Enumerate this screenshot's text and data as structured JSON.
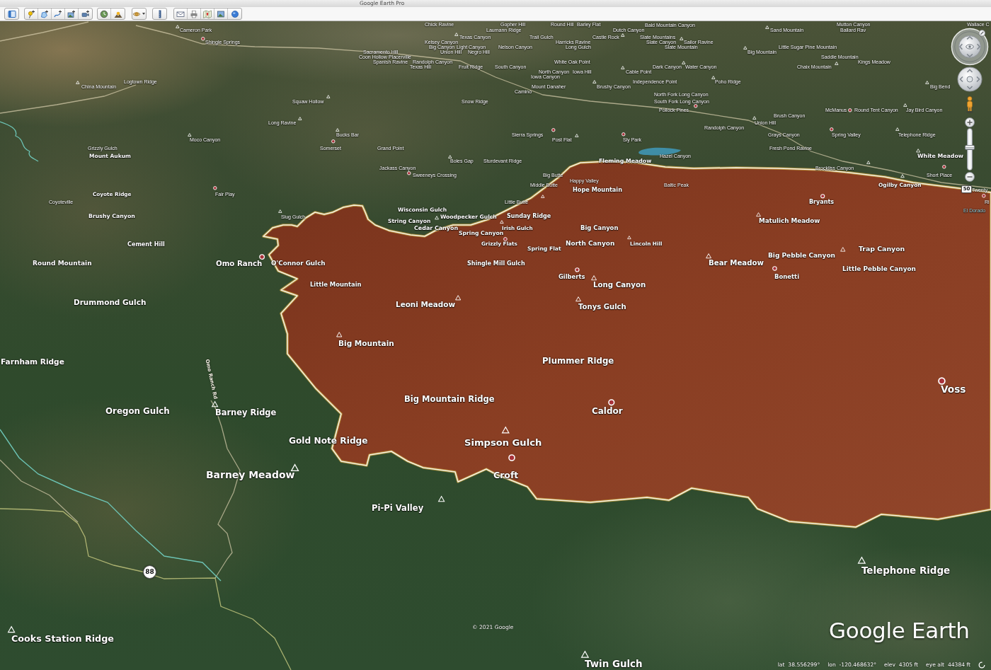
{
  "window": {
    "title": "Google Earth Pro"
  },
  "map": {
    "places": [
      {
        "name": "Chick Ravine",
        "kind": "feature"
      },
      {
        "name": "Gopher Hill",
        "kind": "feature"
      },
      {
        "name": "Round Hill",
        "kind": "feature"
      },
      {
        "name": "Barley Flat",
        "kind": "feature"
      },
      {
        "name": "Bald Mountain Canyon",
        "kind": "feature"
      },
      {
        "name": "Mutton Canyon",
        "kind": "feature"
      },
      {
        "name": "Wallace C",
        "kind": "feature"
      },
      {
        "name": "Cameron Park",
        "kind": "summit"
      },
      {
        "name": "Laumann Ridge",
        "kind": "feature"
      },
      {
        "name": "Dutch Canyon",
        "kind": "feature"
      },
      {
        "name": "Sand Mountain",
        "kind": "summit"
      },
      {
        "name": "Ballard Rav",
        "kind": "feature"
      },
      {
        "name": "Texas Canyon",
        "kind": "summit"
      },
      {
        "name": "Trail Gulch",
        "kind": "feature"
      },
      {
        "name": "Castle Rock",
        "kind": "summit"
      },
      {
        "name": "Slate Mountains",
        "kind": "feature"
      },
      {
        "name": "Shingle Springs",
        "kind": "town"
      },
      {
        "name": "Kelsey Canyon",
        "kind": "feature"
      },
      {
        "name": "Harricks Ravine",
        "kind": "feature"
      },
      {
        "name": "Slate Canyon",
        "kind": "feature"
      },
      {
        "name": "Sailor Ravine",
        "kind": "summit"
      },
      {
        "name": "Big Canyon",
        "kind": "feature"
      },
      {
        "name": "Light Canyon",
        "kind": "feature"
      },
      {
        "name": "Nelson Canyon",
        "kind": "feature"
      },
      {
        "name": "Long Gulch",
        "kind": "feature"
      },
      {
        "name": "Slate Mountain",
        "kind": "feature"
      },
      {
        "name": "Little Sugar Pine Mountain",
        "kind": "feature"
      },
      {
        "name": "Sacramento Hill",
        "kind": "feature"
      },
      {
        "name": "Union Hill",
        "kind": "feature"
      },
      {
        "name": "Negro Hill",
        "kind": "feature"
      },
      {
        "name": "Big Mountain",
        "kind": "summit"
      },
      {
        "name": "Coon Hollow",
        "kind": "feature"
      },
      {
        "name": "Placerville",
        "kind": "feature"
      },
      {
        "name": "Saddle Mountain",
        "kind": "feature"
      },
      {
        "name": "Spanish Ravine",
        "kind": "feature"
      },
      {
        "name": "Randolph Canyon",
        "kind": "feature"
      },
      {
        "name": "White Oak Point",
        "kind": "feature"
      },
      {
        "name": "Kings Meadow",
        "kind": "feature"
      },
      {
        "name": "Texas Hill",
        "kind": "feature"
      },
      {
        "name": "Fruit Ridge",
        "kind": "feature"
      },
      {
        "name": "South Canyon",
        "kind": "feature"
      },
      {
        "name": "Dark Canyon",
        "kind": "feature"
      },
      {
        "name": "Water Canyon",
        "kind": "summit"
      },
      {
        "name": "Chaix Mountain",
        "kind": "summit"
      },
      {
        "name": "North Canyon",
        "kind": "feature"
      },
      {
        "name": "Iowa Hill",
        "kind": "feature"
      },
      {
        "name": "Cable Point",
        "kind": "summit"
      },
      {
        "name": "Iowa Canyon",
        "kind": "feature"
      },
      {
        "name": "Logtown Ridge",
        "kind": "feature"
      },
      {
        "name": "Independence Point",
        "kind": "feature"
      },
      {
        "name": "Poho Ridge",
        "kind": "summit"
      },
      {
        "name": "China Mountain",
        "kind": "summit"
      },
      {
        "name": "Mount Danaher",
        "kind": "feature"
      },
      {
        "name": "Brushy Canyon",
        "kind": "summit"
      },
      {
        "name": "Big Bend",
        "kind": "summit"
      },
      {
        "name": "Camino",
        "kind": "feature"
      },
      {
        "name": "North Fork Long Canyon",
        "kind": "feature"
      },
      {
        "name": "Squaw Hollow",
        "kind": "summit"
      },
      {
        "name": "Snow Ridge",
        "kind": "feature"
      },
      {
        "name": "South Fork Long Canyon",
        "kind": "feature"
      },
      {
        "name": "Pollock Pines",
        "kind": "town"
      },
      {
        "name": "McManus",
        "kind": "town"
      },
      {
        "name": "Round Tent Canyon",
        "kind": "feature"
      },
      {
        "name": "Jay Bird Canyon",
        "kind": "summit"
      },
      {
        "name": "Brush Canyon",
        "kind": "feature"
      },
      {
        "name": "Long Ravine",
        "kind": "summit"
      },
      {
        "name": "Union Hill",
        "kind": "summit"
      },
      {
        "name": "Randolph Canyon",
        "kind": "feature"
      },
      {
        "name": "Bucks Bar",
        "kind": "summit"
      },
      {
        "name": "Sierra Springs",
        "kind": "town"
      },
      {
        "name": "Grays Canyon",
        "kind": "feature"
      },
      {
        "name": "Spring Valley",
        "kind": "town"
      },
      {
        "name": "Telephone Ridge",
        "kind": "summit"
      },
      {
        "name": "Moco Canyon",
        "kind": "summit"
      },
      {
        "name": "Post Flat",
        "kind": "summit"
      },
      {
        "name": "Sly Park",
        "kind": "town"
      },
      {
        "name": "Grizzly Gulch",
        "kind": "feature"
      },
      {
        "name": "Somerset",
        "kind": "town"
      },
      {
        "name": "Grand Point",
        "kind": "feature"
      },
      {
        "name": "Fresh Pond Ravine",
        "kind": "feature"
      },
      {
        "name": "Mount Aukum",
        "kind": "feature"
      },
      {
        "name": "Hazel Canyon",
        "kind": "feature"
      },
      {
        "name": "White Meadow",
        "kind": "summit"
      },
      {
        "name": "Boles Gap",
        "kind": "summit"
      },
      {
        "name": "Sturdevant Ridge",
        "kind": "feature"
      },
      {
        "name": "Fleming Meadow",
        "kind": "feature"
      },
      {
        "name": "Jackass Canyon",
        "kind": "feature"
      },
      {
        "name": "Brockliss Canyon",
        "kind": "summit"
      },
      {
        "name": "Sweeneys Crossing",
        "kind": "town"
      },
      {
        "name": "Big Butte",
        "kind": "feature"
      },
      {
        "name": "Short Place",
        "kind": "town"
      },
      {
        "name": "Happy Valley",
        "kind": "feature"
      },
      {
        "name": "Middle Butte",
        "kind": "feature"
      },
      {
        "name": "Baltic Peak",
        "kind": "feature"
      },
      {
        "name": "Ogilby Canyon",
        "kind": "summit"
      },
      {
        "name": "Hope Mountain",
        "kind": "feature"
      },
      {
        "name": "Twenty",
        "kind": "feature"
      },
      {
        "name": "Coyote Ridge",
        "kind": "feature"
      },
      {
        "name": "Fair Play",
        "kind": "town"
      },
      {
        "name": "Coyoteville",
        "kind": "feature"
      },
      {
        "name": "Little Butte",
        "kind": "summit"
      },
      {
        "name": "Bryants",
        "kind": "town"
      },
      {
        "name": "Ri",
        "kind": "town"
      },
      {
        "name": "Wisconsin Gulch",
        "kind": "feature"
      },
      {
        "name": "El Dorado",
        "kind": "region"
      },
      {
        "name": "Brushy Canyon",
        "kind": "feature"
      },
      {
        "name": "Slug Gulch",
        "kind": "summit"
      },
      {
        "name": "Woodpecker Gulch",
        "kind": "summit"
      },
      {
        "name": "Sunday Ridge",
        "kind": "feature"
      },
      {
        "name": "String Canyon",
        "kind": "feature"
      },
      {
        "name": "Matulich Meadow",
        "kind": "summit"
      },
      {
        "name": "Cedar Canyon",
        "kind": "feature"
      },
      {
        "name": "Irish Gulch",
        "kind": "summit"
      },
      {
        "name": "Big Canyon",
        "kind": "feature"
      },
      {
        "name": "Spring Canyon",
        "kind": "feature"
      },
      {
        "name": "Cement Hill",
        "kind": "feature"
      },
      {
        "name": "Grizzly Flats",
        "kind": "town"
      },
      {
        "name": "North Canyon",
        "kind": "feature"
      },
      {
        "name": "Lincoln Hill",
        "kind": "summit"
      },
      {
        "name": "Spring Flat",
        "kind": "feature"
      },
      {
        "name": "Trap Canyon",
        "kind": "summit"
      },
      {
        "name": "Big Pebble Canyon",
        "kind": "feature"
      },
      {
        "name": "Round Mountain",
        "kind": "feature"
      },
      {
        "name": "Omo Ranch",
        "kind": "town"
      },
      {
        "name": "O'Connor Gulch",
        "kind": "feature"
      },
      {
        "name": "Shingle Mill Gulch",
        "kind": "feature"
      },
      {
        "name": "Bear Meadow",
        "kind": "summit"
      },
      {
        "name": "Little Pebble Canyon",
        "kind": "feature"
      },
      {
        "name": "Gilberts",
        "kind": "town"
      },
      {
        "name": "Bonetti",
        "kind": "town"
      },
      {
        "name": "Little Mountain",
        "kind": "feature"
      },
      {
        "name": "Long Canyon",
        "kind": "summit"
      },
      {
        "name": "Drummond Gulch",
        "kind": "feature"
      },
      {
        "name": "Leoni Meadow",
        "kind": "summit"
      },
      {
        "name": "Tonys Gulch",
        "kind": "summit"
      },
      {
        "name": "Big Mountain",
        "kind": "summit"
      },
      {
        "name": "Farnham Ridge",
        "kind": "feature"
      },
      {
        "name": "Plummer Ridge",
        "kind": "feature"
      },
      {
        "name": "Voss",
        "kind": "town"
      },
      {
        "name": "Big Mountain Ridge",
        "kind": "feature"
      },
      {
        "name": "Oregon Gulch",
        "kind": "feature"
      },
      {
        "name": "Barney Ridge",
        "kind": "summit"
      },
      {
        "name": "Caldor",
        "kind": "town"
      },
      {
        "name": "Gold Note Ridge",
        "kind": "feature"
      },
      {
        "name": "Simpson Gulch",
        "kind": "summit"
      },
      {
        "name": "Barney Meadow",
        "kind": "summit"
      },
      {
        "name": "Croft",
        "kind": "town"
      },
      {
        "name": "Pi-Pi Valley",
        "kind": "summit"
      },
      {
        "name": "Telephone Ridge",
        "kind": "summit"
      },
      {
        "name": "Cooks Station Ridge",
        "kind": "summit"
      },
      {
        "name": "Twin Gulch",
        "kind": "summit"
      }
    ],
    "road_labels": [
      "Omo Ranch Rd"
    ],
    "highway_shields": [
      "88",
      "50"
    ],
    "copyright": "© 2021 Google",
    "logo": "Google Earth"
  },
  "navigation": {
    "zoom_slider": {
      "level": 0.55
    }
  },
  "status_bar": [
    {
      "label": "lat",
      "value": "38.556299°"
    },
    {
      "label": "lon",
      "value": "-120.468632°"
    },
    {
      "label": "elev",
      "value": "4305 ft"
    },
    {
      "label": "eye alt",
      "value": "44384 ft"
    }
  ]
}
